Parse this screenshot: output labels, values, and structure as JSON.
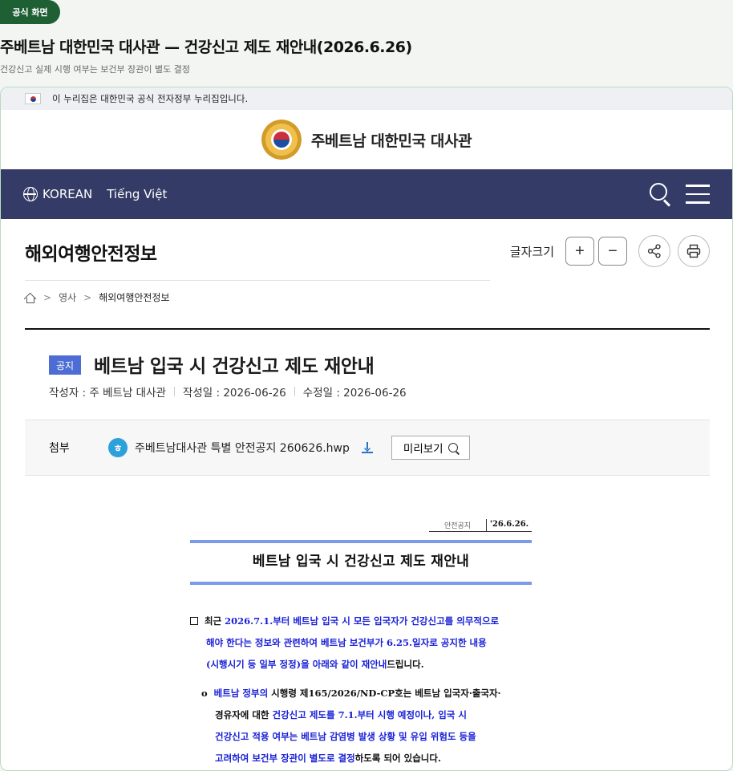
{
  "header": {
    "badge": "공식 화면",
    "heading": "주베트남 대한민국 대사관 — 건강신고 제도 재안내(2026.6.26)",
    "subheading": "건강신고 실제 시행 여부는 보건부 장관이 별도 결정"
  },
  "gov_notice": "이 누리집은 대한민국 공식 전자정부 누리집입니다.",
  "site": {
    "name": "주베트남 대한민국 대사관"
  },
  "nav": {
    "lang_ko": "KOREAN",
    "lang_vi": "Tiếng Việt"
  },
  "section": {
    "title": "해외여행안전정보",
    "font_size_label": "글자크기",
    "plus": "+",
    "minus": "−"
  },
  "breadcrumb": {
    "level1": "영사",
    "level2": "해외여행안전정보",
    "sep": ">"
  },
  "article": {
    "tag": "공지",
    "title": "베트남 입국 시 건강신고 제도 재안내",
    "author": "작성자 : 주 베트남 대사관",
    "created": "작성일 : 2026-06-26",
    "modified": "수정일 : 2026-06-26"
  },
  "attachment": {
    "label": "첨부",
    "file_icon": "ㅎ",
    "file_name": "주베트남대사관 특별 안전공지 260626.hwp",
    "preview_label": "미리보기"
  },
  "document": {
    "stamp_label": "안전공지",
    "stamp_date": "'26.6.26.",
    "title": "베트남 입국 시 건강신고 제도 재안내",
    "p1": {
      "a": "최근 ",
      "b": "2026.7.1.부터 베트남 입국 시 모든 입국자가 건강신고를 의무적으로",
      "c": "해야 한다는 정보와 관련하여 베트남 보건부가 6.25.일자로 공지한 내용",
      "d": "(시행시기 등 일부 정정)을 아래와 같이 재안내",
      "e": "드립니다."
    },
    "p2": {
      "bullet": "o",
      "a": "베트남 정부의",
      "b": " 시행령 제165/2026/ND-CP호는 베트남 입국자·출국자·",
      "c": "경유자에 대한 ",
      "d": "건강신고 제도를 7.1.부터 시행 예정이나, 입국 시",
      "e": "건강신고 적용 여부는 베트남 감염병 발생 상황 및 유입 위험도 등을",
      "f": "고려하여 보건부 장관이 별도로 결정",
      "g": "하도록 되어 있습니다."
    }
  },
  "colors": {
    "badge_green": "#1f5f34",
    "nav_bg": "#343b66",
    "notice_tag": "#4e6dd4",
    "doc_blue_text": "#1a21d6",
    "doc_bar": "#7d9ae6"
  },
  "icons": [
    "korea-flag-icon",
    "embassy-emblem-icon",
    "globe-icon",
    "search-icon",
    "menu-icon",
    "share-icon",
    "print-icon",
    "home-icon",
    "hwp-file-icon",
    "download-icon",
    "magnifier-icon"
  ]
}
